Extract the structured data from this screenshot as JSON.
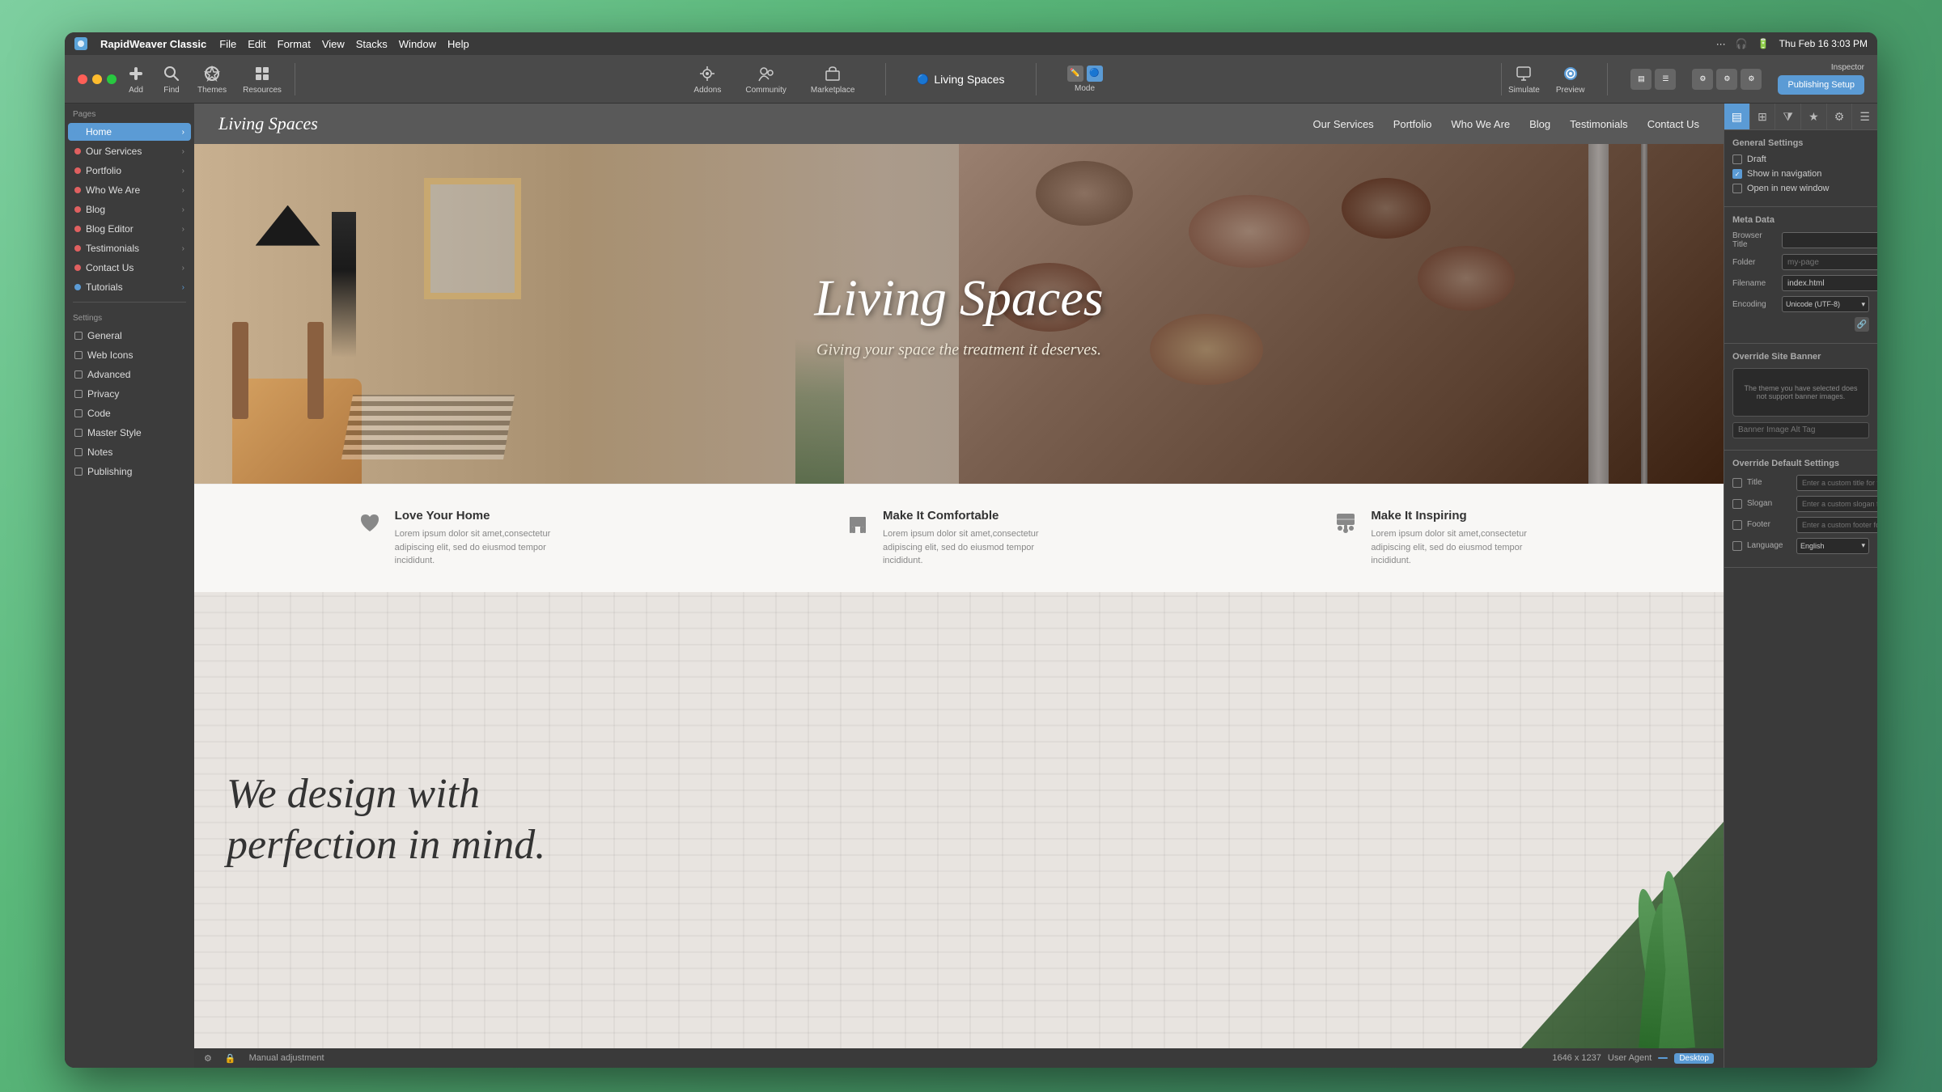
{
  "app": {
    "name": "RapidWeaver Classic",
    "title": "Living Spaces",
    "window_title": "Living Spaces"
  },
  "menubar": {
    "menus": [
      "File",
      "Edit",
      "Format",
      "View",
      "Stacks",
      "Window",
      "Help"
    ],
    "right_items": [
      "···",
      "🎧",
      "🔋",
      "Thu Feb 16  3:03 PM"
    ]
  },
  "toolbar": {
    "left_buttons": [
      {
        "icon": "＋",
        "label": "Add"
      },
      {
        "icon": "🔍",
        "label": "Find"
      },
      {
        "icon": "🎨",
        "label": "Themes"
      },
      {
        "icon": "📦",
        "label": "Resources"
      }
    ],
    "center_buttons": [
      {
        "icon": "⊕",
        "label": "Addons"
      },
      {
        "icon": "👥",
        "label": "Community"
      },
      {
        "icon": "🛒",
        "label": "Marketplace"
      }
    ],
    "mode_label": "Mode",
    "mode_icons": [
      "✏️",
      "🔵"
    ],
    "right_buttons": [
      {
        "icon": "📱",
        "label": "Simulate"
      },
      {
        "icon": "👁",
        "label": "Preview"
      }
    ],
    "view_icons": [
      "grid",
      "list",
      "table",
      "gear1",
      "gear2",
      "gear3"
    ],
    "publishing_setup": "Publishing Setup",
    "inspector_label": "Inspector",
    "publishing_setup_label": "Publishing Setup"
  },
  "sidebar": {
    "pages_label": "Pages",
    "pages": [
      {
        "name": "Home",
        "color": "#5b9bd5",
        "active": true
      },
      {
        "name": "Our Services",
        "color": "#e06060"
      },
      {
        "name": "Portfolio",
        "color": "#e06060"
      },
      {
        "name": "Who We Are",
        "color": "#e06060"
      },
      {
        "name": "Blog",
        "color": "#e06060"
      },
      {
        "name": "Blog Editor",
        "color": "#e06060"
      },
      {
        "name": "Testimonials",
        "color": "#e06060"
      },
      {
        "name": "Contact Us",
        "color": "#e06060"
      },
      {
        "name": "Tutorials",
        "color": "#5b9bd5"
      }
    ],
    "settings_label": "Settings",
    "settings": [
      {
        "name": "General"
      },
      {
        "name": "Web Icons"
      },
      {
        "name": "Advanced"
      },
      {
        "name": "Privacy"
      },
      {
        "name": "Code"
      },
      {
        "name": "Master Style"
      },
      {
        "name": "Notes"
      },
      {
        "name": "Publishing"
      }
    ]
  },
  "site_nav": {
    "logo": "Living Spaces",
    "links": [
      "Our Services",
      "Portfolio",
      "Who We Are",
      "Blog",
      "Testimonials",
      "Contact Us"
    ]
  },
  "hero": {
    "title": "Living Spaces",
    "subtitle": "Giving your space the treatment it deserves."
  },
  "features": [
    {
      "icon": "♥",
      "title": "Love Your Home",
      "desc": "Lorem ipsum dolor sit amet,consectetur adipiscing elit, sed do eiusmod tempor incididunt."
    },
    {
      "icon": "🪑",
      "title": "Make It Comfortable",
      "desc": "Lorem ipsum dolor sit amet,consectetur adipiscing elit, sed do eiusmod tempor incididunt."
    },
    {
      "icon": "🎨",
      "title": "Make It Inspiring",
      "desc": "Lorem ipsum dolor sit amet,consectetur adipiscing elit, sed do eiusmod tempor incididunt."
    }
  ],
  "design_section": {
    "line1": "We design with",
    "line2": "perfection in mind."
  },
  "inspector": {
    "tabs": [
      "grid",
      "table",
      "sliders",
      "star",
      "gear",
      "cog"
    ],
    "general_settings_label": "General Settings",
    "checkboxes": [
      {
        "label": "Draft",
        "checked": false
      },
      {
        "label": "Show in navigation",
        "checked": true
      },
      {
        "label": "Open in new window",
        "checked": false
      }
    ],
    "meta_data_label": "Meta Data",
    "browser_title_label": "Browser Title",
    "folder_label": "Folder",
    "folder_placeholder": "my-page",
    "filename_label": "Filename",
    "filename_value": "index.html",
    "encoding_label": "Encoding",
    "encoding_value": "Unicode (UTF-8)",
    "override_site_banner_label": "Override Site Banner",
    "banner_placeholder_text": "The theme you have selected does not support banner images.",
    "banner_alt_tag_label": "Banner Image Alt Tag",
    "override_default_settings_label": "Override Default Settings",
    "override_fields": [
      {
        "label": "Title",
        "placeholder": "Enter a custom title for this pag"
      },
      {
        "label": "Slogan",
        "placeholder": "Enter a custom slogan for this p"
      },
      {
        "label": "Footer",
        "placeholder": "Enter a custom footer for this p"
      },
      {
        "label": "Language",
        "value": "English"
      }
    ]
  },
  "status_bar": {
    "adjustment": "Manual adjustment",
    "dimensions": "1646 x 1237",
    "user_agent": "User Agent",
    "desktop": "Desktop"
  }
}
